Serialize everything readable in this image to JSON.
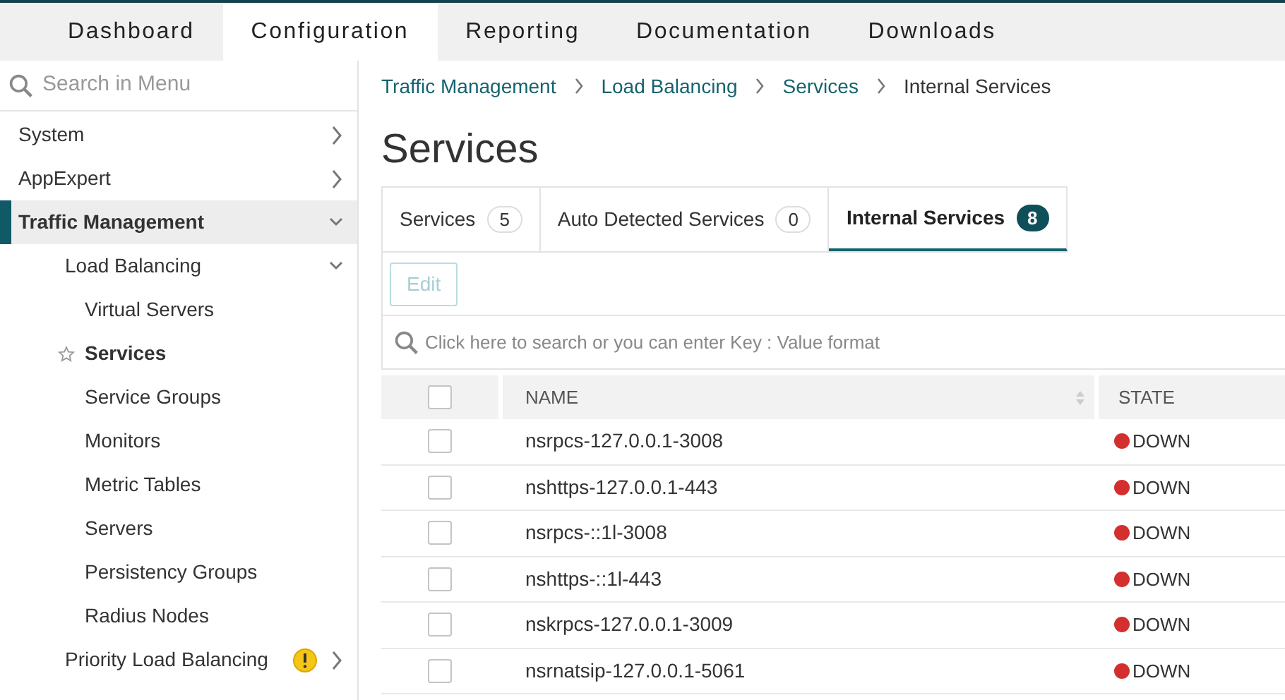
{
  "top_nav": [
    {
      "label": "Dashboard",
      "selected": false
    },
    {
      "label": "Configuration",
      "selected": true
    },
    {
      "label": "Reporting",
      "selected": false
    },
    {
      "label": "Documentation",
      "selected": false
    },
    {
      "label": "Downloads",
      "selected": false
    }
  ],
  "sidebar": {
    "search": {
      "placeholder": "Search in Menu"
    },
    "items": [
      {
        "label": "System",
        "expanded": false,
        "selected": false
      },
      {
        "label": "AppExpert",
        "expanded": false,
        "selected": false
      },
      {
        "label": "Traffic Management",
        "expanded": true,
        "selected": true,
        "children": [
          {
            "label": "Load Balancing",
            "expanded": true,
            "selected": false,
            "children": [
              {
                "label": "Virtual Servers",
                "selected": false
              },
              {
                "label": "Services",
                "selected": true,
                "starred": false
              },
              {
                "label": "Service Groups",
                "selected": false
              },
              {
                "label": "Monitors",
                "selected": false
              },
              {
                "label": "Metric Tables",
                "selected": false
              },
              {
                "label": "Servers",
                "selected": false
              },
              {
                "label": "Persistency Groups",
                "selected": false
              },
              {
                "label": "Radius Nodes",
                "selected": false
              }
            ]
          },
          {
            "label": "Priority Load Balancing",
            "expanded": false,
            "selected": false,
            "warning": true
          }
        ]
      }
    ]
  },
  "breadcrumb": [
    {
      "label": "Traffic Management",
      "link": true
    },
    {
      "label": "Load Balancing",
      "link": true
    },
    {
      "label": "Services",
      "link": true
    },
    {
      "label": "Internal Services",
      "link": false
    }
  ],
  "title": "Services",
  "tabs": [
    {
      "label": "Services",
      "count": "5",
      "selected": false
    },
    {
      "label": "Auto Detected Services",
      "count": "0",
      "selected": false
    },
    {
      "label": "Internal Services",
      "count": "8",
      "selected": true
    }
  ],
  "edit_button": {
    "label": "Edit",
    "disabled": true
  },
  "search": {
    "placeholder": "Click here to search or you can enter Key : Value format"
  },
  "table": {
    "select_all": {
      "checked": false
    },
    "columns": [
      "NAME",
      "STATE"
    ],
    "rows": [
      {
        "name": "nsrpcs-127.0.0.1-3008",
        "state": "DOWN",
        "color": "#d32f2f",
        "checked": false
      },
      {
        "name": "nshttps-127.0.0.1-443",
        "state": "DOWN",
        "color": "#d32f2f",
        "checked": false
      },
      {
        "name": "nsrpcs-::1l-3008",
        "state": "DOWN",
        "color": "#d32f2f",
        "checked": false
      },
      {
        "name": "nshttps-::1l-443",
        "state": "DOWN",
        "color": "#d32f2f",
        "checked": false
      },
      {
        "name": "nskrpcs-127.0.0.1-3009",
        "state": "DOWN",
        "color": "#d32f2f",
        "checked": false
      },
      {
        "name": "nsrnatsip-127.0.0.1-5061",
        "state": "DOWN",
        "color": "#d32f2f",
        "checked": false
      }
    ]
  }
}
